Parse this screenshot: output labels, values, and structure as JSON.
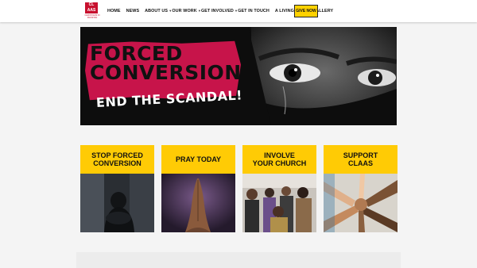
{
  "header": {
    "logo": {
      "mark_text": "CL AAS",
      "tagline": "CHRISTIANS IN PAKISTAN"
    },
    "nav": [
      {
        "label": "HOME",
        "dropdown": false
      },
      {
        "label": "NEWS",
        "dropdown": false
      },
      {
        "label": "ABOUT US",
        "dropdown": true
      },
      {
        "label": "OUR WORK",
        "dropdown": true
      },
      {
        "label": "GET INVOLVED",
        "dropdown": true
      },
      {
        "label": "GET IN TOUCH",
        "dropdown": false
      },
      {
        "label": "A LIVING HELL",
        "dropdown": false
      },
      {
        "label": "GALLERY",
        "dropdown": false
      }
    ],
    "give_label": "GIVE NOW"
  },
  "hero": {
    "title_line1": "FORCED",
    "title_line2": "CONVERSION",
    "subtitle": "END THE SCANDAL!"
  },
  "cards": [
    {
      "line1": "STOP FORCED",
      "line2": "CONVERSION",
      "image": "girl-sitting-dark-room"
    },
    {
      "line1": "PRAY TODAY",
      "line2": "",
      "image": "praying-hands"
    },
    {
      "line1": "INVOLVE",
      "line2": "YOUR CHURCH",
      "image": "congregation-worship"
    },
    {
      "line1": "SUPPORT",
      "line2": "CLAAS",
      "image": "stacked-hands"
    }
  ],
  "colors": {
    "accent_yellow": "#ffcb05",
    "brand_red": "#c8102e",
    "hero_red": "#c7144a"
  }
}
